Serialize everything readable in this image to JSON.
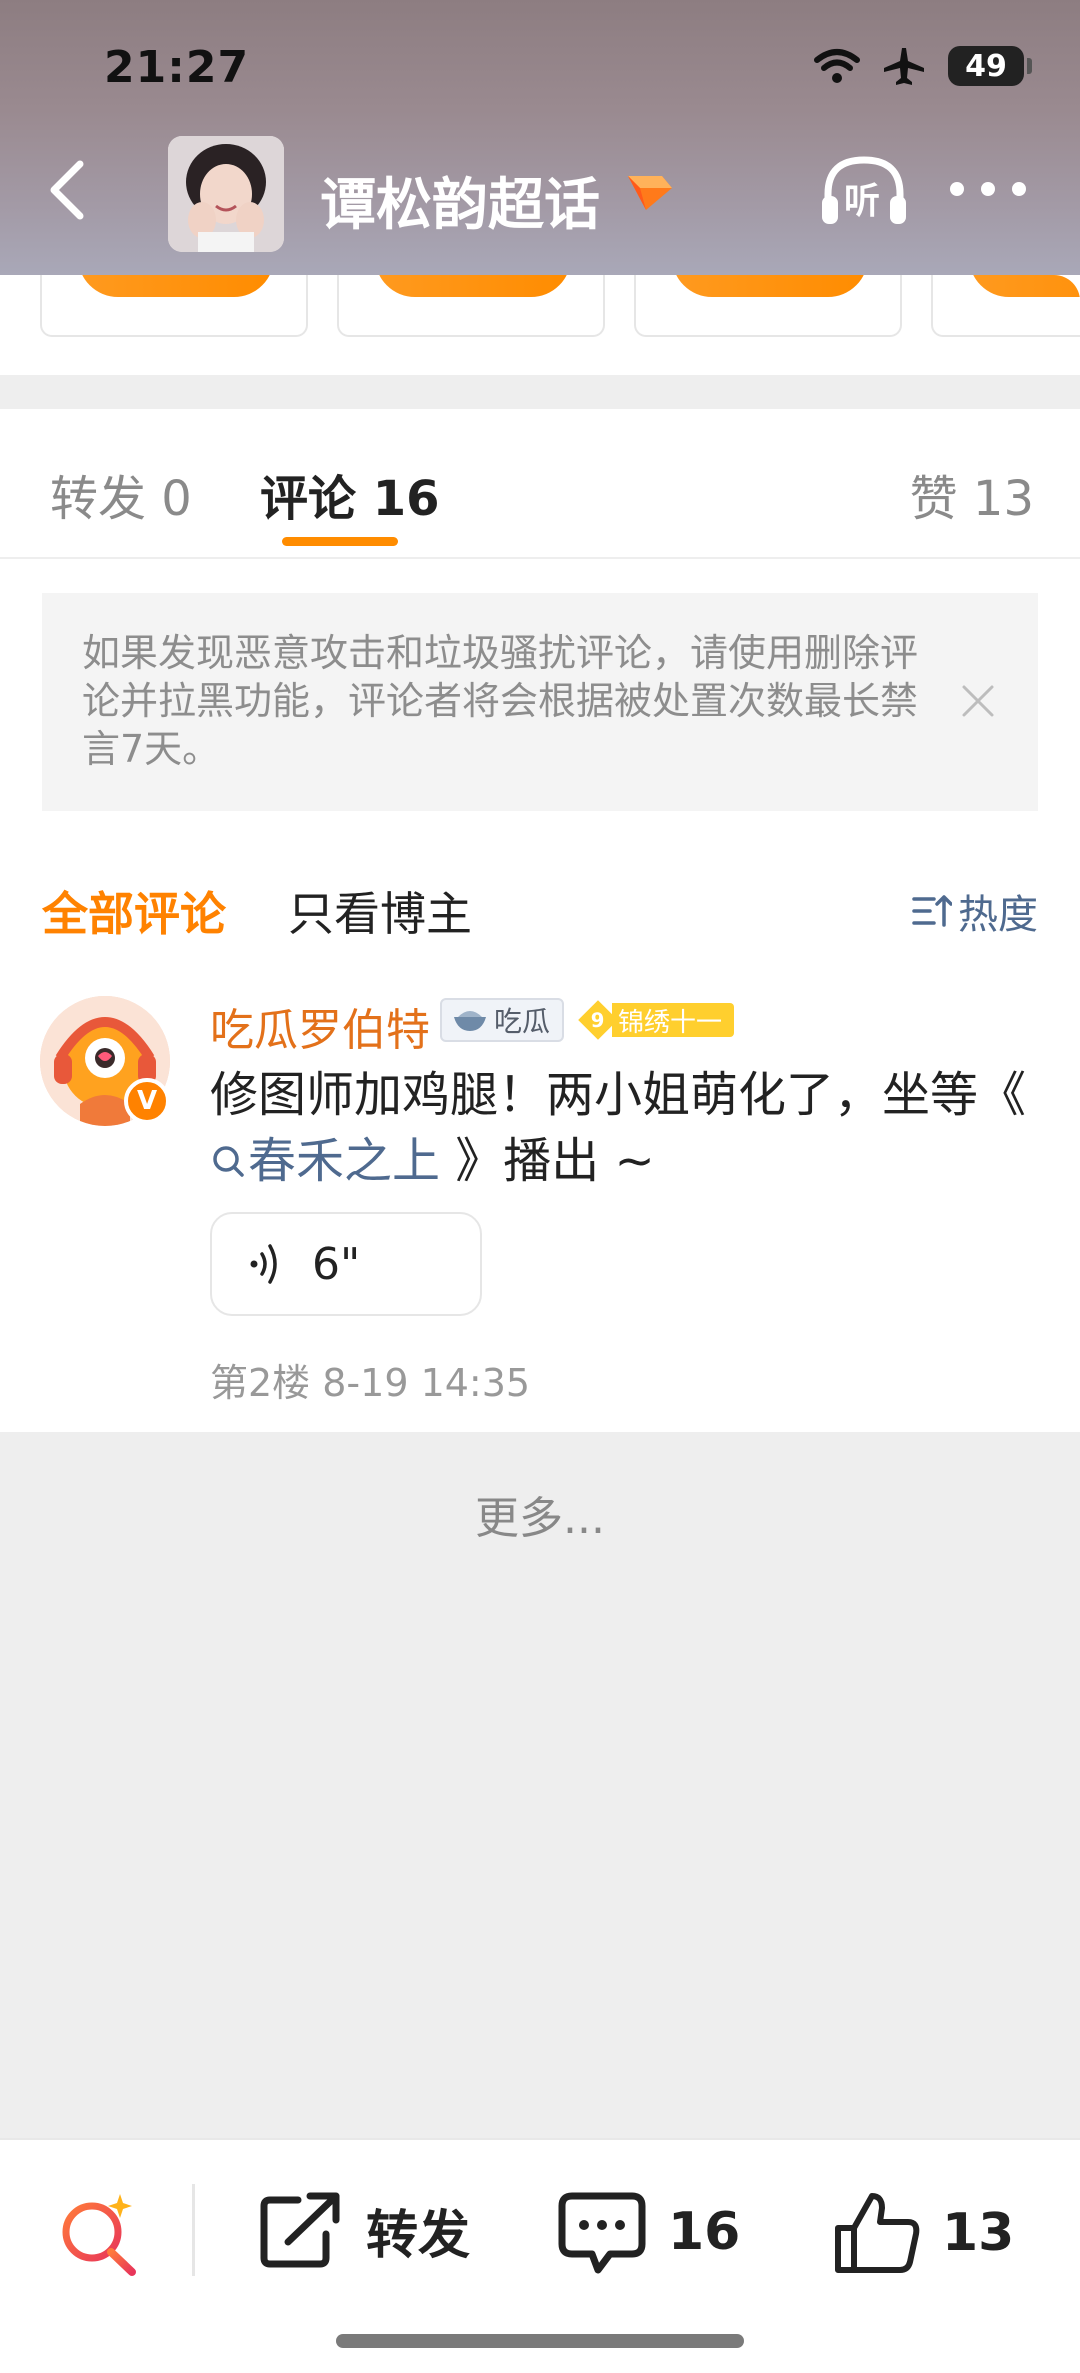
{
  "status_bar": {
    "time": "21:27",
    "battery": "49"
  },
  "header": {
    "title": "谭松韵超话",
    "listen_label": "听"
  },
  "tabs": [
    {
      "label": "转发 0"
    },
    {
      "label": "评论 16"
    },
    {
      "label": "赞 13"
    }
  ],
  "notice": {
    "text": "如果发现恶意攻击和垃圾骚扰评论，请使用删除评论并拉黑功能，评论者将会根据被处置次数最长禁言7天。"
  },
  "filter": {
    "all_label": "全部评论",
    "blogger_label": "只看博主",
    "sort_label": "热度"
  },
  "comment": {
    "username": "吃瓜罗伯特",
    "badge_chigua": "吃瓜",
    "badge_level": "9",
    "badge_title": "锦绣十一",
    "verified": "V",
    "text_before": "修图师加鸡腿！两小姐萌化了，坐等《",
    "topic": "春禾之上",
    "text_after": " 》播出 ~",
    "voice_length": "6\"",
    "meta": "第2楼  8-19 14:35"
  },
  "more_label": "更多...",
  "bottom_bar": {
    "repost_label": "转发",
    "comment_count": "16",
    "like_count": "13"
  },
  "colors": {
    "accent": "#ff8200",
    "link": "#4f6a8f",
    "username": "#e3711a"
  }
}
